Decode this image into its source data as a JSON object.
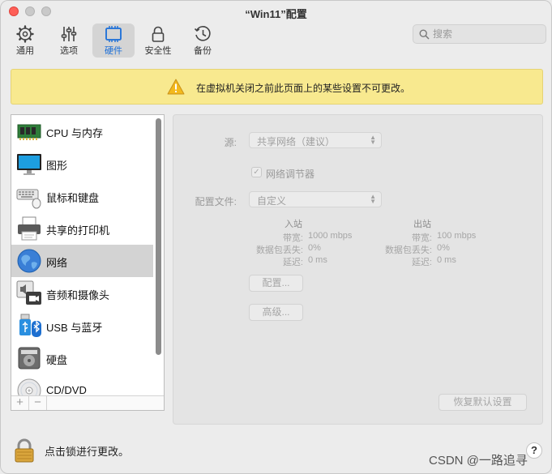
{
  "window": {
    "title": "“Win11”配置"
  },
  "toolbar": {
    "tabs": [
      {
        "label": "通用",
        "icon": "gear-icon"
      },
      {
        "label": "选项",
        "icon": "sliders-icon"
      },
      {
        "label": "硬件",
        "icon": "chip-icon",
        "active": true
      },
      {
        "label": "安全性",
        "icon": "lock-icon"
      },
      {
        "label": "备份",
        "icon": "clock-history-icon"
      }
    ],
    "search_placeholder": "搜索",
    "accent": "#1a6ed8"
  },
  "banner": {
    "text": "在虚拟机关闭之前此页面上的某些设置不可更改。",
    "background": "#f8e98f"
  },
  "devices": [
    {
      "label": "CPU 与内存",
      "icon": "cpu-memory-icon"
    },
    {
      "label": "图形",
      "icon": "monitor-icon"
    },
    {
      "label": "鼠标和键盘",
      "icon": "keyboard-mouse-icon"
    },
    {
      "label": "共享的打印机",
      "icon": "printer-icon"
    },
    {
      "label": "网络",
      "icon": "globe-icon",
      "selected": true
    },
    {
      "label": "音频和摄像头",
      "icon": "speaker-camera-icon"
    },
    {
      "label": "USB 与蓝牙",
      "icon": "usb-bluetooth-icon"
    },
    {
      "label": "硬盘",
      "icon": "hard-disk-icon"
    },
    {
      "label": "CD/DVD",
      "icon": "cd-dvd-icon"
    }
  ],
  "list_footer": {
    "add": "+",
    "remove": "−"
  },
  "network": {
    "source_label": "源:",
    "source_value": "共享网络（建议）",
    "conditioner_label": "网络调节器",
    "profile_label": "配置文件:",
    "profile_value": "自定义",
    "inbound": {
      "header": "入站",
      "bandwidth_label": "带宽:",
      "bandwidth": "1000 mbps",
      "loss_label": "数据包丢失:",
      "loss": "0%",
      "delay_label": "延迟:",
      "delay": "0 ms"
    },
    "outbound": {
      "header": "出站",
      "bandwidth_label": "带宽:",
      "bandwidth": "100 mbps",
      "loss_label": "数据包丢失:",
      "loss": "0%",
      "delay_label": "延迟:",
      "delay": "0 ms"
    },
    "configure_button": "配置...",
    "advanced_button": "高级...",
    "restore_button": "恢复默认设置"
  },
  "footer": {
    "lock_text": "点击锁进行更改。",
    "help": "?",
    "watermark": "CSDN @一路追寻"
  }
}
